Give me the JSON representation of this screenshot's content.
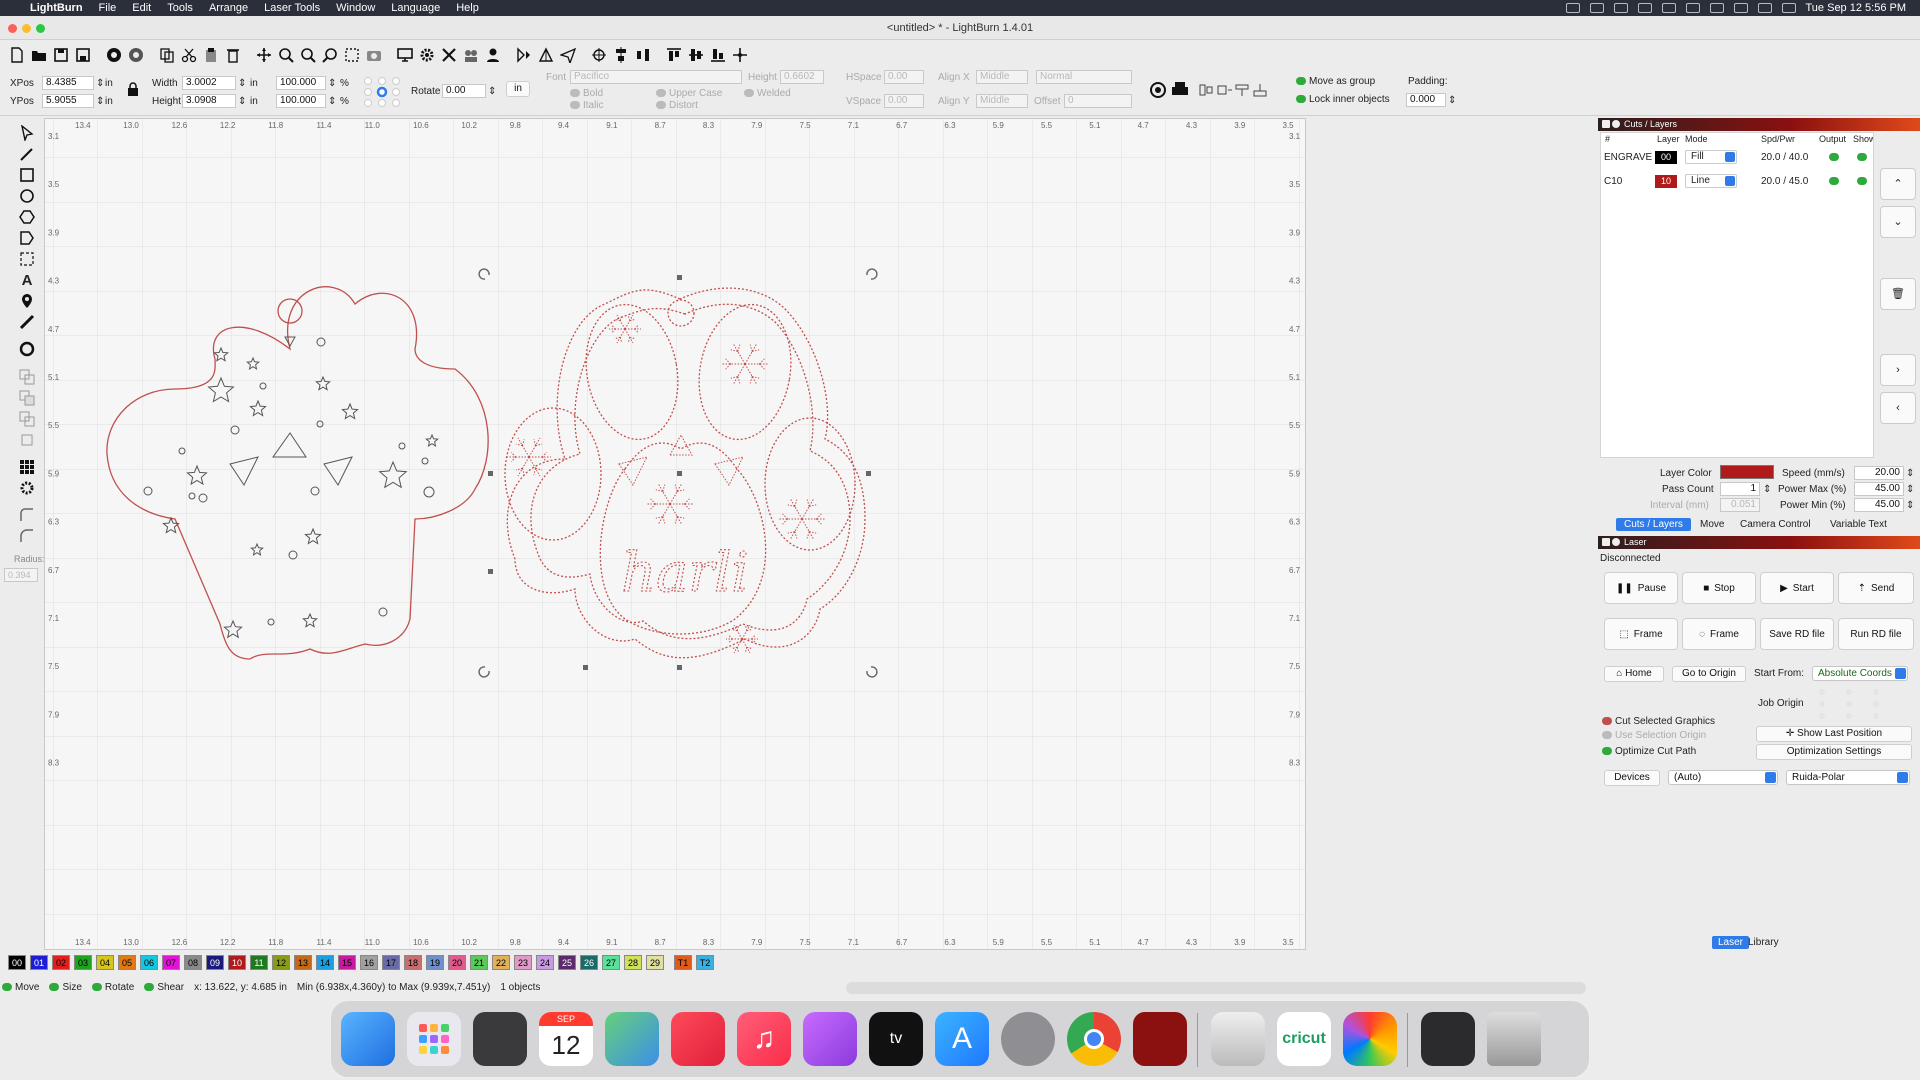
{
  "menubar": {
    "app": "LightBurn",
    "items": [
      "File",
      "Edit",
      "Tools",
      "Arrange",
      "Laser Tools",
      "Window",
      "Language",
      "Help"
    ],
    "datetime": "Tue Sep 12  5:56 PM"
  },
  "window": {
    "title": "<untitled> * - LightBurn 1.4.01"
  },
  "numeric": {
    "xpos_label": "XPos",
    "xpos": "8.4385",
    "ypos_label": "YPos",
    "ypos": "5.9055",
    "unit": "in",
    "width_label": "Width",
    "width": "3.0002",
    "height_label": "Height",
    "height": "3.0908",
    "scale_w": "100.000",
    "scale_h": "100.000",
    "pct": "%",
    "rotate_label": "Rotate",
    "rotate": "0.00",
    "in_button": "in",
    "font_label": "Font",
    "font": "Pacifico",
    "font_height_label": "Height",
    "font_height": "0.6602",
    "hspace_label": "HSpace",
    "hspace": "0.00",
    "vspace_label": "VSpace",
    "vspace": "0.00",
    "alignx_label": "Align X",
    "alignx": "Middle",
    "aligny_label": "Align Y",
    "aligny": "Middle",
    "normal": "Normal",
    "offset_label": "Offset",
    "offset": "0",
    "bold": "Bold",
    "italic": "Italic",
    "upper": "Upper Case",
    "distort": "Distort",
    "welded": "Welded",
    "move_group": "Move as group",
    "lock_inner": "Lock inner objects",
    "padding_label": "Padding:",
    "padding": "0.000"
  },
  "lefttools": {
    "radius_label": "Radius:",
    "radius": "0.394"
  },
  "ruler": {
    "top": [
      "13.4",
      "13.0",
      "12.6",
      "12.2",
      "11.8",
      "11.4",
      "11.0",
      "10.6",
      "10.2",
      "9.8",
      "9.4",
      "9.1",
      "8.7",
      "8.3",
      "7.9",
      "7.5",
      "7.1",
      "6.7",
      "6.3",
      "5.9",
      "5.5",
      "5.1",
      "4.7",
      "4.3",
      "3.9",
      "3.5"
    ],
    "left": [
      "3.1",
      "3.5",
      "3.9",
      "4.3",
      "4.7",
      "5.1",
      "5.5",
      "5.9",
      "6.3",
      "6.7",
      "7.1",
      "7.5",
      "7.9",
      "8.3"
    ]
  },
  "design": {
    "text": "harli"
  },
  "palette": [
    "00",
    "01",
    "02",
    "03",
    "04",
    "05",
    "06",
    "07",
    "08",
    "09",
    "10",
    "11",
    "12",
    "13",
    "14",
    "15",
    "16",
    "17",
    "18",
    "19",
    "20",
    "21",
    "22",
    "23",
    "24",
    "25",
    "26",
    "27",
    "28",
    "29",
    "T1",
    "T2"
  ],
  "palette_colors": [
    "#000000",
    "#1d1dd6",
    "#e11d1d",
    "#1fa31f",
    "#d6c51a",
    "#e07a13",
    "#13c7e0",
    "#e013d6",
    "#8a8a8a",
    "#1a1a7a",
    "#b01a1a",
    "#1f7a1f",
    "#8a9b1a",
    "#c26a1a",
    "#1aa0e0",
    "#c71aa0",
    "#a0a0a0",
    "#6a6aa6",
    "#c86e6e",
    "#6e8fc8",
    "#e05a8e",
    "#5ac85a",
    "#e0b05a",
    "#e09ac8",
    "#c89ae0",
    "#5a2a6a",
    "#1a6a6a",
    "#5ae09a",
    "#d0e05a",
    "#e0e0a0",
    "#e05a1a",
    "#3ab0e0"
  ],
  "status": {
    "move": "Move",
    "size": "Size",
    "rotate": "Rotate",
    "shear": "Shear",
    "coords": "x: 13.622, y: 4.685 in",
    "bounds": "Min (6.938x,4.360y) to Max (9.939x,7.451y)",
    "objects": "1 objects"
  },
  "cuts": {
    "title": "Cuts / Layers",
    "cols": [
      "#",
      "Layer",
      "Mode",
      "Spd/Pwr",
      "Output",
      "Show"
    ],
    "rows": [
      {
        "name": "ENGRAVE",
        "layer": "00",
        "layer_color": "#000000",
        "mode": "Fill",
        "spdpwr": "20.0 / 40.0"
      },
      {
        "name": "C10",
        "layer": "10",
        "layer_color": "#b01a1a",
        "mode": "Line",
        "spdpwr": "20.0 / 45.0"
      }
    ],
    "layer_color_label": "Layer Color",
    "pass_count_label": "Pass Count",
    "pass_count": "1",
    "interval_label": "Interval (mm)",
    "interval": "0.051",
    "speed_label": "Speed (mm/s)",
    "speed": "20.00",
    "pmax_label": "Power Max (%)",
    "pmax": "45.00",
    "pmin_label": "Power Min (%)",
    "pmin": "45.00",
    "tabs": [
      "Cuts / Layers",
      "Move",
      "Camera Control",
      "Variable Text"
    ]
  },
  "laser": {
    "title": "Laser",
    "state": "Disconnected",
    "pause": "Pause",
    "stop": "Stop",
    "start": "Start",
    "send": "Send",
    "frame1": "Frame",
    "frame2": "Frame",
    "save_rd": "Save RD file",
    "run_rd": "Run RD file",
    "home": "Home",
    "go_origin": "Go to Origin",
    "start_from_label": "Start From:",
    "start_from": "Absolute Coords",
    "job_origin": "Job Origin",
    "cut_selected": "Cut Selected Graphics",
    "use_sel_origin": "Use Selection Origin",
    "optimize": "Optimize Cut Path",
    "show_last": "Show Last Position",
    "opt_settings": "Optimization Settings",
    "devices": "Devices",
    "auto": "(Auto)",
    "device": "Ruida-Polar",
    "tabs": [
      "Laser",
      "Library"
    ]
  },
  "dock": {
    "calendar_month": "SEP",
    "calendar_day": "12",
    "cricut": "cricut"
  }
}
